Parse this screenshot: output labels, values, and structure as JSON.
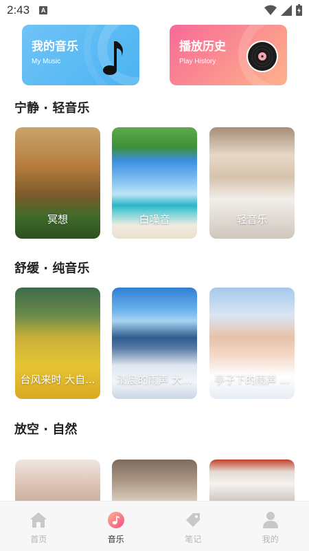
{
  "status_bar": {
    "time": "2:43",
    "app_badge": "A"
  },
  "top_cards": [
    {
      "title": "我的音乐",
      "subtitle": "My Music",
      "icon": "music-note-icon"
    },
    {
      "title": "播放历史",
      "subtitle": "Play History",
      "icon": "vinyl-record-icon"
    }
  ],
  "sections": [
    {
      "title": "宁静 · 轻音乐",
      "items": [
        {
          "label": "冥想",
          "image": "forest"
        },
        {
          "label": "白噪音",
          "image": "beach"
        },
        {
          "label": "轻音乐",
          "image": "bedroom"
        }
      ]
    },
    {
      "title": "舒缓 · 纯音乐",
      "items": [
        {
          "label": "台风来时 大自...",
          "image": "rice-fields"
        },
        {
          "label": "清晨的雨声 大...",
          "image": "clouds"
        },
        {
          "label": "亭子下的雨声 ...",
          "image": "sleeping-girl"
        }
      ]
    },
    {
      "title": "放空 · 自然",
      "items": [
        {
          "label": "",
          "image": "face"
        },
        {
          "label": "",
          "image": "bedroom"
        },
        {
          "label": "",
          "image": "bed"
        }
      ]
    }
  ],
  "bottom_nav": [
    {
      "label": "首页",
      "icon": "home-icon",
      "active": false
    },
    {
      "label": "音乐",
      "icon": "music-icon",
      "active": true
    },
    {
      "label": "笔记",
      "icon": "tag-icon",
      "active": false
    },
    {
      "label": "我的",
      "icon": "user-icon",
      "active": false
    }
  ],
  "colors": {
    "my_music_card": "#4cb3f1",
    "history_card_start": "#f86a97",
    "history_card_end": "#fdb28a",
    "nav_active": "#333333",
    "nav_inactive": "#b5b5b5"
  }
}
